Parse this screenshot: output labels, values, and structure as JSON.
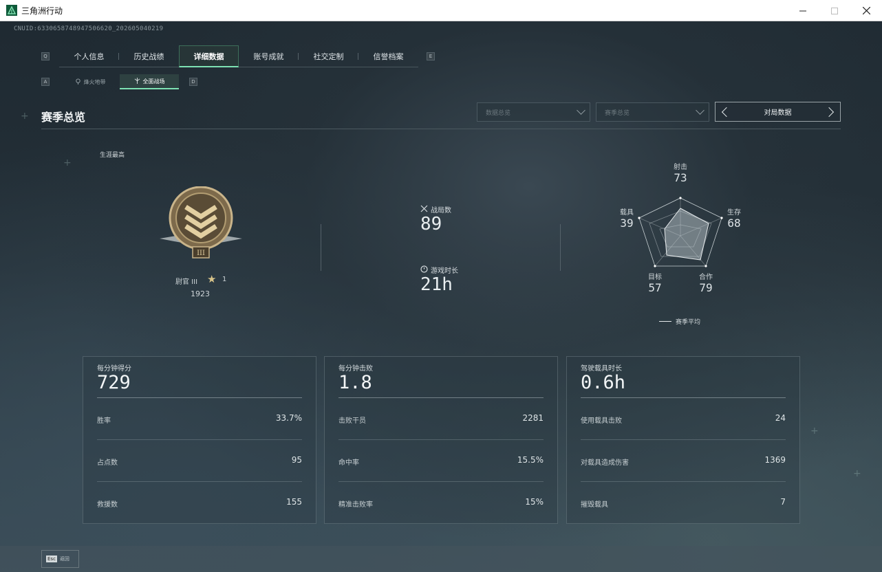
{
  "window": {
    "title": "三角洲行动",
    "minimize_icon": "minimize-icon",
    "maximize_icon": "maximize-icon",
    "close_icon": "close-icon"
  },
  "uid_text": "CNUID:6330658748947506620_202605040219",
  "nav": {
    "left_key": "Q",
    "right_key": "E",
    "tabs": [
      {
        "label": "个人信息",
        "active": false
      },
      {
        "label": "历史战绩",
        "active": false
      },
      {
        "label": "详细数据",
        "active": true
      },
      {
        "label": "账号成就",
        "active": false
      },
      {
        "label": "社交定制",
        "active": false
      },
      {
        "label": "信誉档案",
        "active": false
      }
    ]
  },
  "subnav": {
    "left_key": "A",
    "right_key": "D",
    "tabs": [
      {
        "label": "烽火地带",
        "icon": "landmark-icon",
        "active": false
      },
      {
        "label": "全面战场",
        "icon": "battlefield-icon",
        "active": true
      }
    ]
  },
  "section": {
    "title": "赛季总览",
    "dropdown_data": "数据总览",
    "dropdown_season": "赛季总览",
    "stepper_label": "对局数据"
  },
  "career": {
    "label": "生涯最高",
    "rank_name": "尉官 III",
    "rank_stars": "1",
    "rank_points": "1923"
  },
  "summary": {
    "matches_label": "战局数",
    "matches_value": "89",
    "playtime_label": "游戏时长",
    "playtime_value": "21h"
  },
  "radar": {
    "axes": [
      {
        "label": "射击",
        "value": "73"
      },
      {
        "label": "生存",
        "value": "68"
      },
      {
        "label": "合作",
        "value": "79"
      },
      {
        "label": "目标",
        "value": "57"
      },
      {
        "label": "载具",
        "value": "39"
      }
    ],
    "legend": "赛季平均"
  },
  "cards": [
    {
      "title": "每分钟得分",
      "value": "729",
      "rows": [
        {
          "label": "胜率",
          "value": "33.7%"
        },
        {
          "label": "占点数",
          "value": "95"
        },
        {
          "label": "救援数",
          "value": "155"
        }
      ]
    },
    {
      "title": "每分钟击败",
      "value": "1.8",
      "rows": [
        {
          "label": "击败干员",
          "value": "2281"
        },
        {
          "label": "命中率",
          "value": "15.5%"
        },
        {
          "label": "精准击败率",
          "value": "15%"
        }
      ]
    },
    {
      "title": "驾驶载具时长",
      "value": "0.6h",
      "rows": [
        {
          "label": "使用载具击败",
          "value": "24"
        },
        {
          "label": "对载具造成伤害",
          "value": "1369"
        },
        {
          "label": "摧毁载具",
          "value": "7"
        }
      ]
    }
  ],
  "footer": {
    "esc_key": "Esc",
    "esc_label": "返回"
  }
}
